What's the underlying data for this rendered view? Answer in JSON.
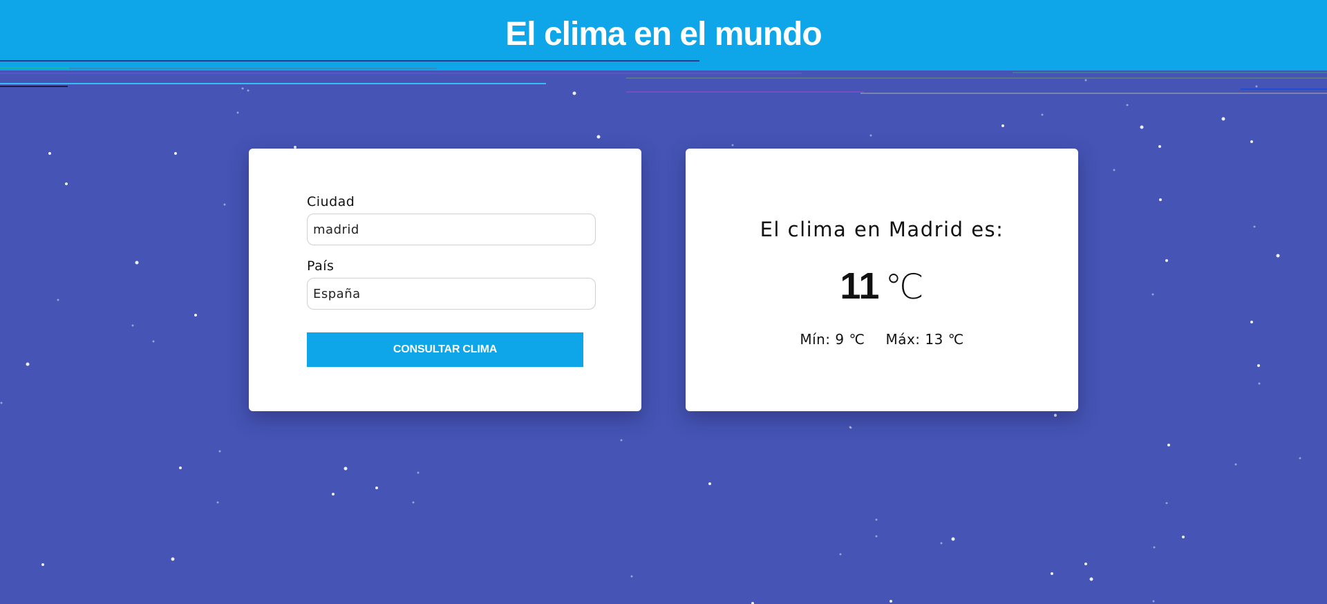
{
  "header": {
    "title": "El clima en el mundo",
    "background_color": "#0ea5e9"
  },
  "page": {
    "background_color": "#4554b5"
  },
  "form": {
    "city_label": "Ciudad",
    "city_value": "madrid",
    "country_label": "País",
    "country_value": "España",
    "submit_label": "CONSULTAR CLIMA",
    "button_color": "#0ea5e9"
  },
  "result": {
    "heading": "El clima en Madrid es:",
    "temperature": "11",
    "unit": "℃",
    "min_text": "Mín: 9 ℃",
    "max_text": "Máx: 13 ℃"
  }
}
